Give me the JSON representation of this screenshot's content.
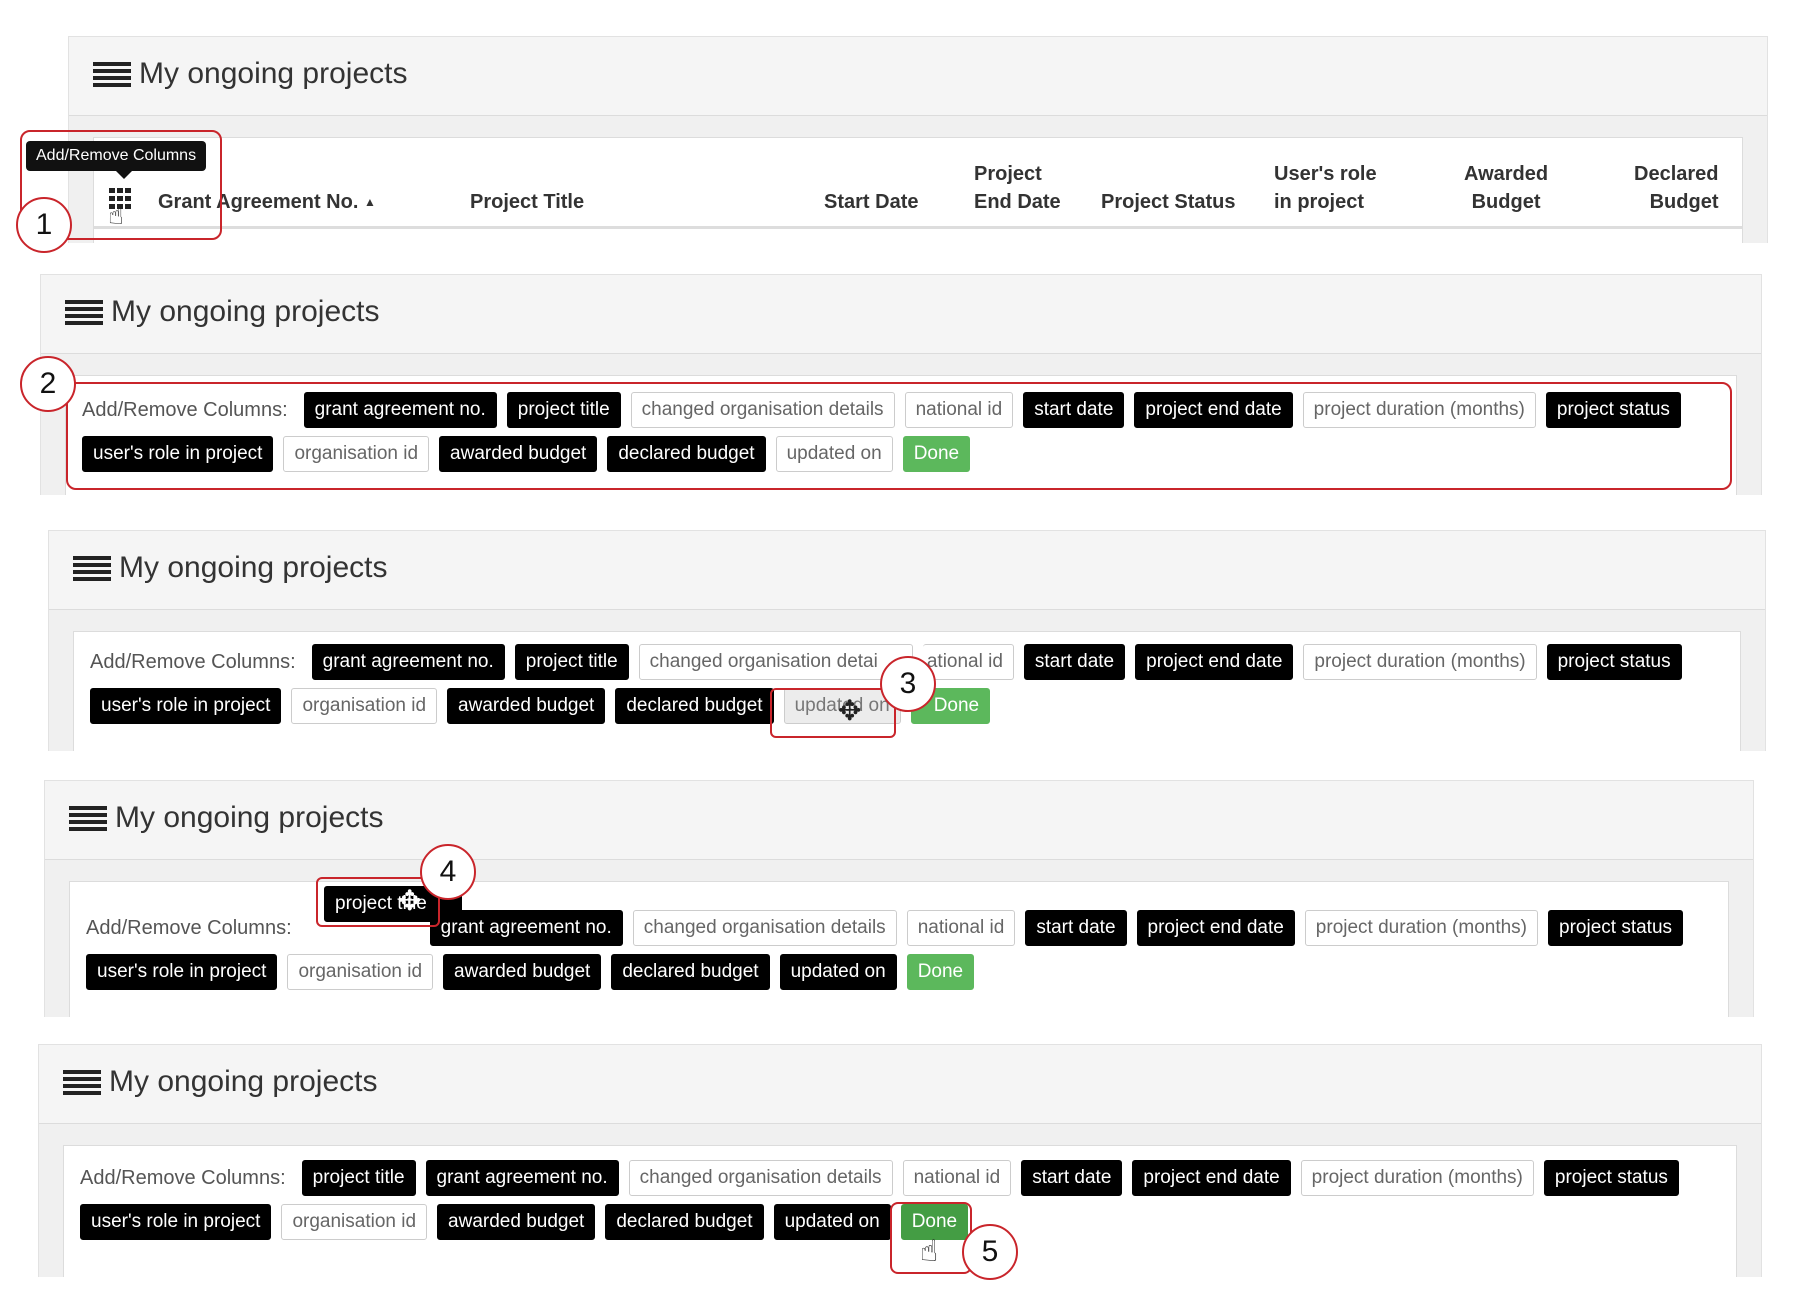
{
  "panel_title": "My ongoing projects",
  "tooltip": "Add/Remove Columns",
  "cols_label": "Add/Remove Columns:",
  "table_headers": {
    "grant_no": "Grant Agreement No.",
    "sort_indicator": "▲",
    "title": "Project Title",
    "start": "Start Date",
    "end_line1": "Project",
    "end_line2": "End Date",
    "status": "Project Status",
    "role_line1": "User's role",
    "role_line2": "in project",
    "awarded_line1": "Awarded",
    "awarded_line2": "Budget",
    "declared_line1": "Declared",
    "declared_line2": "Budget"
  },
  "tags": {
    "grant": "grant agreement no.",
    "title": "project title",
    "changed": "changed organisation details",
    "changed_cut": "changed organisation detai",
    "national": "national id",
    "national_cut": "ational id",
    "start": "start date",
    "end": "project end date",
    "duration": "project duration (months)",
    "status": "project status",
    "role": "user's role in project",
    "org": "organisation id",
    "awarded": "awarded budget",
    "declared": "declared budget",
    "updated": "updated on",
    "done": "Done",
    "done_cut": "Done"
  },
  "steps": [
    "1",
    "2",
    "3",
    "4",
    "5"
  ],
  "icons": {
    "header": "list-icon",
    "columns": "grid-icon",
    "hand": "hand-pointer-icon",
    "move": "move-cursor-icon"
  },
  "colors": {
    "highlight": "#c9252b",
    "selected_tag": "#000000",
    "done": "#5cb85c",
    "done_pressed": "#449d44"
  }
}
